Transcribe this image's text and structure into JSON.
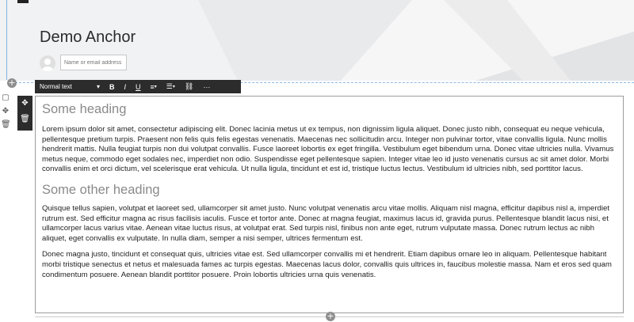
{
  "header": {
    "title": "Demo Anchor",
    "author_placeholder": "Name or email address"
  },
  "toolbar": {
    "style_label": "Normal text",
    "bold": "B",
    "italic": "I",
    "underline": "U",
    "more": "···"
  },
  "content": {
    "heading1": "Some heading",
    "paragraph1": "Lorem ipsum dolor sit amet, consectetur adipiscing elit. Donec lacinia metus ut ex tempus, non dignissim ligula aliquet. Donec justo nibh, consequat eu neque vehicula, pellentesque pretium turpis. Praesent non felis quis felis egestas venenatis. Maecenas nec sollicitudin arcu. Integer non pulvinar tortor, vitae convallis ligula. Nunc mollis hendrerit mattis. Nulla feugiat turpis non dui volutpat convallis. Fusce laoreet lobortis ex eget fringilla. Vestibulum eget bibendum urna. Donec vitae ultricies nulla. Vivamus metus neque, commodo eget sodales nec, imperdiet non odio. Suspendisse eget pellentesque sapien. Integer vitae leo id justo venenatis cursus ac sit amet dolor. Morbi convallis enim et orci dictum, vel scelerisque erat vehicula. Ut nulla ligula, tincidunt et est id, tristique luctus lectus. Vestibulum id ultricies nibh, sed porttitor lacus.",
    "heading2": "Some other heading",
    "paragraph2": "Quisque tellus sapien, volutpat et laoreet sed, ullamcorper sit amet justo. Nunc volutpat venenatis arcu vitae mollis. Aliquam nisl magna, efficitur dapibus nisl a, imperdiet rutrum est. Sed efficitur magna ac risus facilisis iaculis. Fusce et tortor ante. Donec at magna feugiat, maximus lacus id, gravida purus. Pellentesque blandit lacus nisi, et ullamcorper lacus varius vitae. Aenean vitae luctus risus, at volutpat erat. Sed turpis nisl, finibus non ante eget, rutrum vulputate massa. Donec rutrum lectus ac nibh aliquet, eget convallis ex vulputate. In nulla diam, semper a nisi semper, ultrices fermentum est.",
    "paragraph3": "Donec magna justo, tincidunt et consequat quis, ultricies vitae est. Sed ullamcorper convallis mi et hendrerit. Etiam dapibus ornare leo in aliquam. Pellentesque habitant morbi tristique senectus et netus et malesuada fames ac turpis egestas. Maecenas lacus dolor, convallis quis ultrices in, faucibus molestie massa. Nam et eros sed quam condimentum posuere. Aenean blandit porttitor posuere. Proin lobortis ultricies urna quis venenatis."
  },
  "icons": {
    "insert": "plus-circle-icon",
    "left_tools": [
      "note-icon",
      "move-icon",
      "trash-icon"
    ],
    "block_controls": [
      "move-icon",
      "trash-icon"
    ]
  }
}
